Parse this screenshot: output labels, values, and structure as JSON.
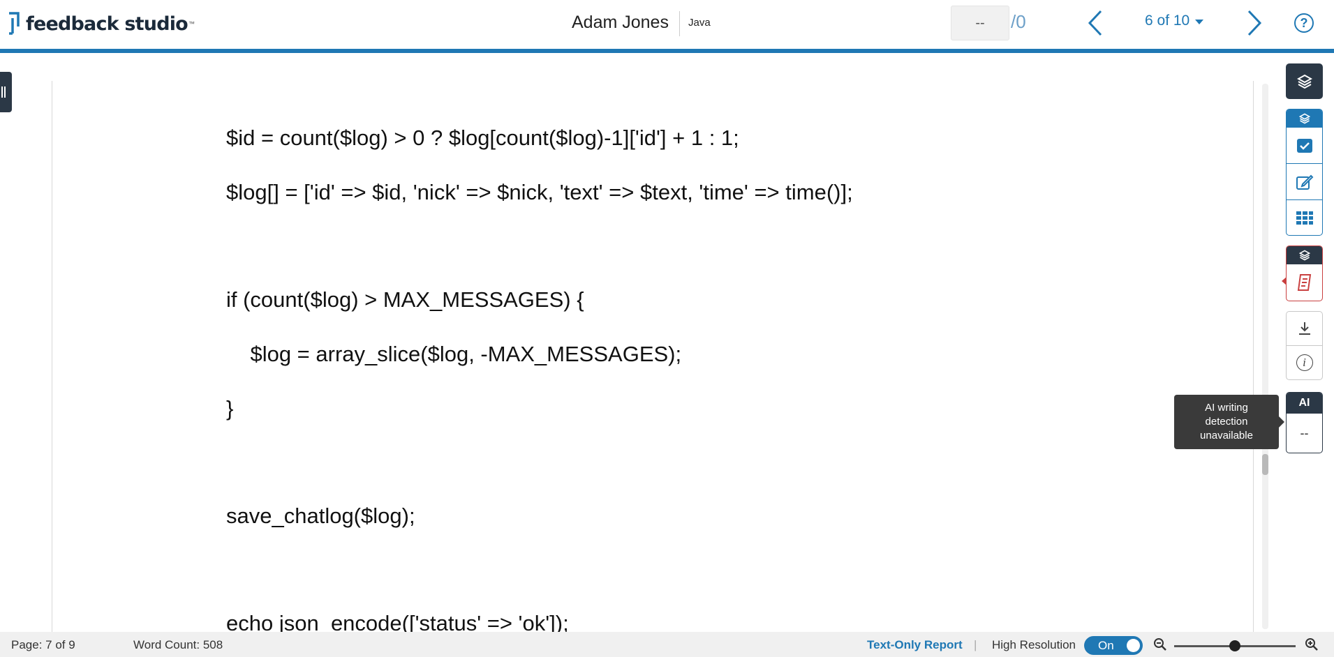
{
  "header": {
    "logo_text": "feedback studio",
    "logo_tm": "™",
    "student_name": "Adam Jones",
    "course": "Java",
    "grade_value": "--",
    "grade_total": "/0",
    "paper_position": "6 of 10",
    "help_symbol": "?",
    "colors": {
      "accent": "#1f78b4",
      "dark": "#2b3846"
    }
  },
  "document": {
    "lines": [
      "$id = count($log) > 0 ? $log[count($log)-1]['id'] + 1 : 1;",
      "$log[] = ['id' => $id, 'nick' => $nick, 'text' => $text, 'time' => time()];",
      "if (count($log) > MAX_MESSAGES) {",
      "    $log = array_slice($log, -MAX_MESSAGES);",
      "}",
      "save_chatlog($log);",
      "echo json_encode(['status' => 'ok']);"
    ]
  },
  "toolbar": {
    "icons": [
      "layers-icon",
      "check-icon",
      "edit-icon",
      "grid-icon",
      "similarity-report-icon",
      "download-icon",
      "info-icon"
    ],
    "ai_label": "AI",
    "ai_value": "--",
    "info_symbol": "i",
    "tooltip": "AI writing detection unavailable"
  },
  "footer": {
    "page_info": "Page: 7 of 9",
    "word_count": "Word Count: 508",
    "text_only_report": "Text-Only Report",
    "separator": "|",
    "high_resolution_label": "High Resolution",
    "toggle_state": "On",
    "zoom_level": 0.5
  }
}
